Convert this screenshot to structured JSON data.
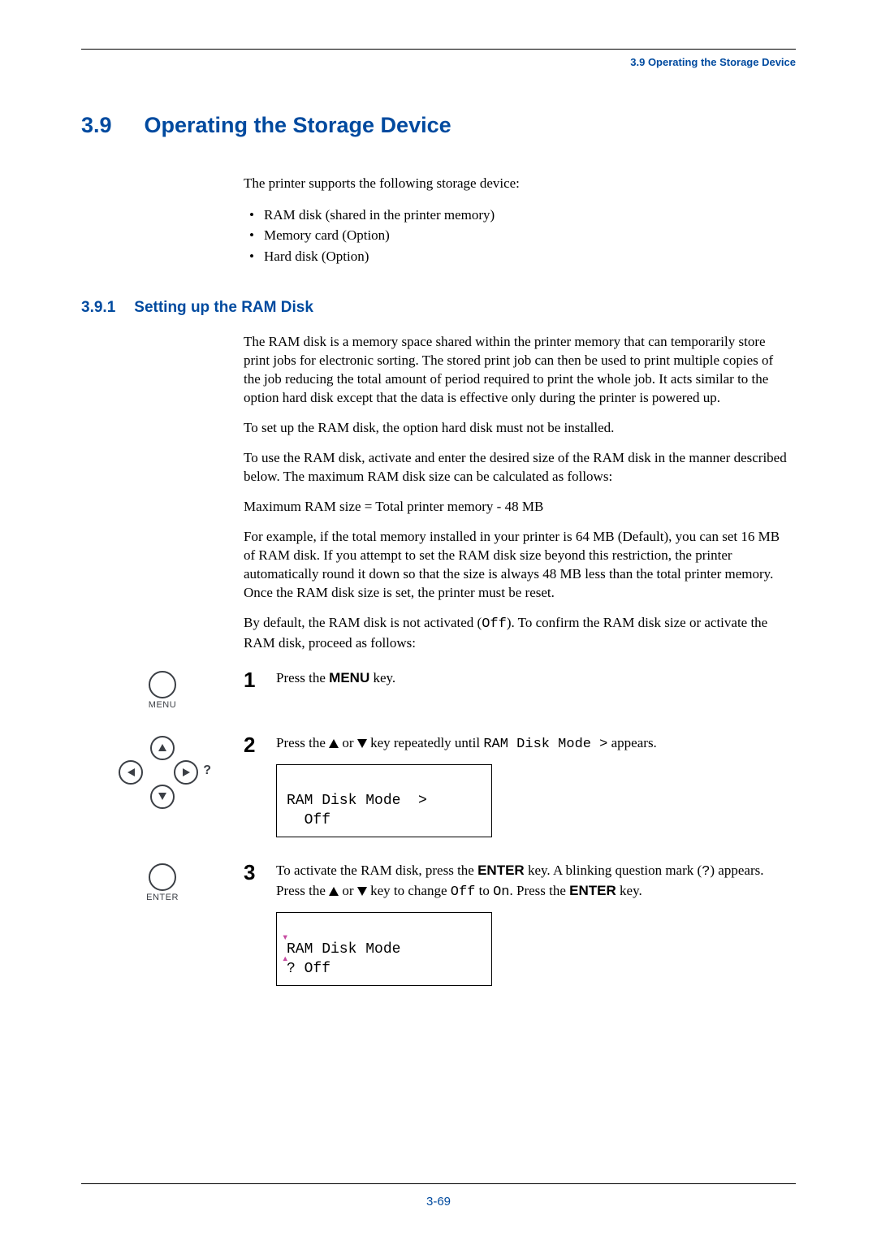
{
  "running_head": "3.9 Operating the Storage Device",
  "section": {
    "num": "3.9",
    "title": "Operating the Storage Device"
  },
  "intro": "The printer supports the following storage device:",
  "bullets": [
    "RAM disk (shared in the printer memory)",
    "Memory card (Option)",
    "Hard disk (Option)"
  ],
  "subsection": {
    "num": "3.9.1",
    "title": "Setting up the RAM Disk"
  },
  "para": {
    "p1": "The RAM disk is a memory space shared within the printer memory that can temporarily store print jobs for electronic sorting. The stored print job can then be used to print multiple copies of the job reducing the total amount of period required to print the whole job. It acts similar to the option hard disk except that the data is effective only during the printer is powered up.",
    "p2": "To set up the RAM disk, the option hard disk must not be installed.",
    "p3": "To use the RAM disk, activate and enter the desired size of the RAM disk in the manner described below. The maximum RAM disk size can be calculated as follows:",
    "p4": "Maximum RAM size = Total printer memory - 48 MB",
    "p5": "For example, if the total memory installed in your printer is 64 MB (Default), you can set 16 MB of RAM disk. If you attempt to set the RAM disk size beyond this restriction, the printer automatically round it down so that the size is always 48 MB less than the total printer memory. Once the RAM disk size is set, the printer must be reset.",
    "p6a": "By default, the RAM disk is not activated (",
    "p6_code": "Off",
    "p6b": "). To confirm the RAM disk size or activate the RAM disk, proceed as follows:"
  },
  "steps": {
    "s1": {
      "num": "1",
      "icon_label": "MENU",
      "text_a": "Press the ",
      "key1": "MENU",
      "text_b": " key."
    },
    "s2": {
      "num": "2",
      "text_a": "Press the  ",
      "text_b": " or ",
      "text_c": " key repeatedly until ",
      "code1": "RAM Disk Mode >",
      "text_d": " appears.",
      "lcd_line1": "RAM Disk Mode  >",
      "lcd_line2": "  Off"
    },
    "s3": {
      "num": "3",
      "icon_label": "ENTER",
      "text_a": "To activate the RAM disk, press the ",
      "key1": "ENTER",
      "text_b": " key. A blinking question mark (",
      "code_q": "?",
      "text_c": ") appears. Press the ",
      "text_d": " or ",
      "text_e": " key to change ",
      "code_off": "Off",
      "text_f": " to ",
      "code_on": "On",
      "text_g": ". Press the ",
      "key2": "ENTER",
      "text_h": " key.",
      "lcd_line1": "RAM Disk Mode",
      "lcd_line2": "? Off"
    }
  },
  "page_number": "3-69"
}
